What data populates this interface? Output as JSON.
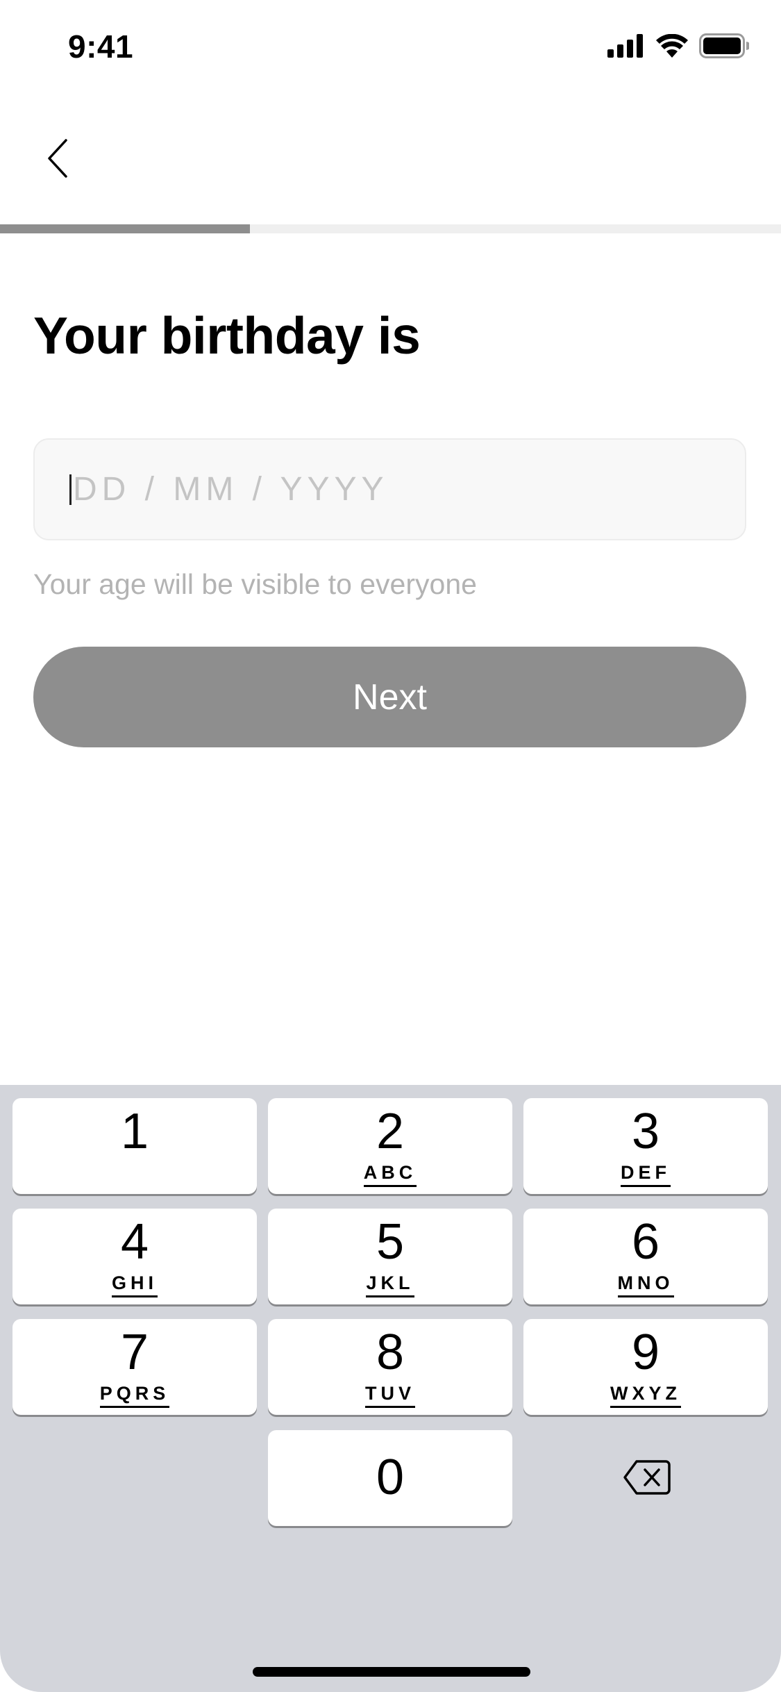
{
  "status_bar": {
    "time": "9:41",
    "icons": [
      "cellular-signal-icon",
      "wifi-icon",
      "battery-icon"
    ]
  },
  "nav": {
    "back_icon": "chevron-left-icon"
  },
  "progress": {
    "fraction": 0.32,
    "fill_color": "#8e8e8e",
    "track_color": "#efefef"
  },
  "title": "Your birthday is",
  "birthday_field": {
    "placeholder": "DD / MM / YYYY",
    "value": ""
  },
  "helper_text": "Your age will be visible to everyone",
  "next_button": {
    "label": "Next",
    "color": "#8e8e8e"
  },
  "keypad": {
    "keys": [
      {
        "digit": "1",
        "letters": ""
      },
      {
        "digit": "2",
        "letters": "ABC"
      },
      {
        "digit": "3",
        "letters": "DEF"
      },
      {
        "digit": "4",
        "letters": "GHI"
      },
      {
        "digit": "5",
        "letters": "JKL"
      },
      {
        "digit": "6",
        "letters": "MNO"
      },
      {
        "digit": "7",
        "letters": "PQRS"
      },
      {
        "digit": "8",
        "letters": "TUV"
      },
      {
        "digit": "9",
        "letters": "WXYZ"
      },
      {
        "digit": "0",
        "letters": ""
      }
    ],
    "delete_icon": "backspace-icon",
    "background": "#d3d5db"
  }
}
